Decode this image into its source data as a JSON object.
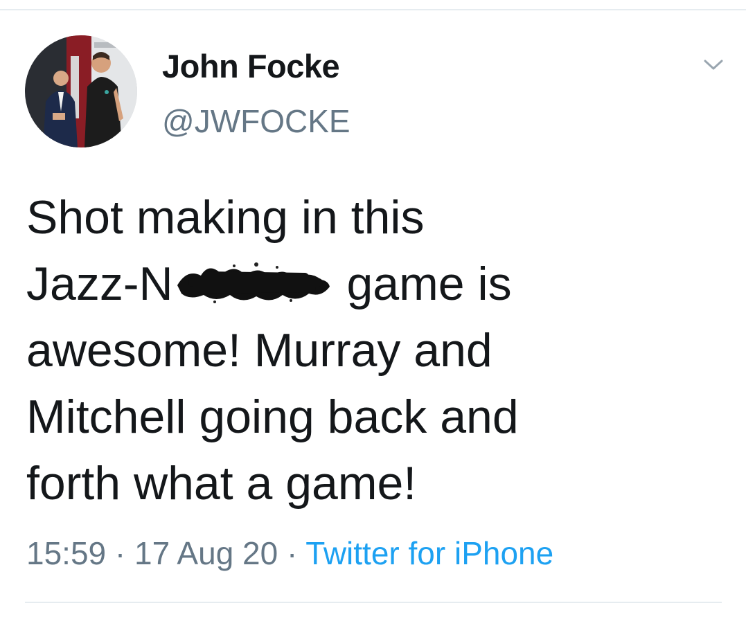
{
  "tweet": {
    "author": {
      "display_name": "John Focke",
      "handle": "@JWFOCKE"
    },
    "text": {
      "line1": "Shot making in this",
      "line2_prefix": "Jazz-N",
      "line2_suffix": " game is",
      "line3": "awesome! Murray and",
      "line4": "Mitchell going back and",
      "line5": "forth what a game!"
    },
    "time": "15:59",
    "separator": " · ",
    "date": "17 Aug 20",
    "source": "Twitter for iPhone"
  },
  "icons": {
    "menu": "chevron-down-icon",
    "redaction": "scribble-redaction"
  },
  "colors": {
    "text_primary": "#14171a",
    "text_secondary": "#657786",
    "link": "#1da1f2",
    "divider": "#e6ecf0"
  }
}
